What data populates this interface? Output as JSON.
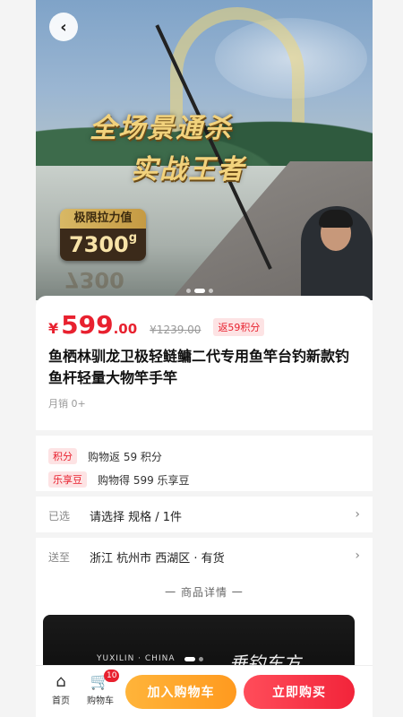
{
  "hero": {
    "headline_line1": "全场景通杀",
    "headline_line2": "实战王者",
    "power_label": "极限拉力值",
    "power_value": "7300",
    "power_unit": "g",
    "slide_index": 2,
    "slide_count": 3
  },
  "price": {
    "currency": "¥",
    "integer": "599",
    "decimal": ".00",
    "original": "¥1239.00",
    "points_tag": "返59积分"
  },
  "product": {
    "title": "鱼栖林驯龙卫极轻鲢鳙二代专用鱼竿台钓新款钓鱼杆轻量大物竿手竿",
    "monthly_sales": "月销 0+"
  },
  "perks": [
    {
      "tag": "积分",
      "text": "购物返 59 积分"
    },
    {
      "tag": "乐享豆",
      "text": "购物得 599 乐享豆"
    }
  ],
  "options": {
    "selected_label": "已选",
    "selected_value": "请选择 规格 / 1件",
    "ship_label": "送至",
    "ship_value": "浙江 杭州市 西湖区 · 有货"
  },
  "details": {
    "header": "一 商品详情 一",
    "image_brand": "YUXILIN · CHINA",
    "image_script": "垂钓东方"
  },
  "bottom_bar": {
    "home_label": "首页",
    "cart_label": "购物车",
    "cart_count": "10",
    "add_to_cart": "加入购物车",
    "buy_now": "立即购买"
  },
  "colors": {
    "accent_red": "#e8212f",
    "cart_orange": "#ff9a1f",
    "gold": "#f2d27c"
  },
  "icons": [
    "back-icon",
    "home-icon",
    "cart-icon",
    "chevron-right-icon"
  ]
}
